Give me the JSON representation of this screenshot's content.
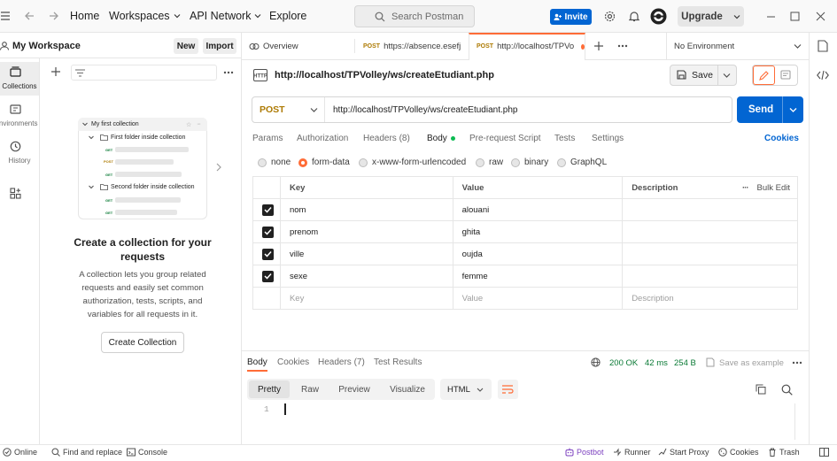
{
  "topbar": {
    "nav": [
      "Home",
      "Workspaces",
      "API Network",
      "Explore"
    ],
    "search_placeholder": "Search Postman",
    "invite_label": "Invite",
    "upgrade_label": "Upgrade"
  },
  "sidebar": {
    "workspace_title": "My Workspace",
    "new_label": "New",
    "import_label": "Import",
    "rail": [
      {
        "label": "Collections",
        "icon": "collections-icon"
      },
      {
        "label": "Environments",
        "icon": "environments-icon"
      },
      {
        "label": "History",
        "icon": "history-icon"
      },
      {
        "label": "",
        "icon": "apps-icon"
      }
    ],
    "illustration": {
      "collection": "My first collection",
      "folder1": "First folder inside collection",
      "folder2": "Second folder inside collection",
      "get": "GET",
      "post": "POST"
    },
    "empty_title": "Create a collection for your requests",
    "empty_desc": "A collection lets you group related requests and easily set common authorization, tests, scripts, and variables for all requests in it.",
    "create_label": "Create Collection"
  },
  "tabs": {
    "overview": "Overview",
    "tab1_method": "POST",
    "tab1_label": "https://absence.esefj",
    "tab2_method": "POST",
    "tab2_label": "http://localhost/TPVo",
    "environment": "No Environment"
  },
  "request": {
    "name": "http://localhost/TPVolley/ws/createEtudiant.php",
    "save_label": "Save",
    "method": "POST",
    "url": "http://localhost/TPVolley/ws/createEtudiant.php",
    "send_label": "Send",
    "tabs": [
      "Params",
      "Authorization",
      "Headers (8)",
      "Body",
      "Pre-request Script",
      "Tests",
      "Settings"
    ],
    "cookies_label": "Cookies",
    "body_types": [
      "none",
      "form-data",
      "x-www-form-urlencoded",
      "raw",
      "binary",
      "GraphQL"
    ],
    "table": {
      "headers": [
        "Key",
        "Value",
        "Description"
      ],
      "bulk_edit": "Bulk Edit",
      "rows": [
        {
          "key": "nom",
          "value": "alouani"
        },
        {
          "key": "prenom",
          "value": "ghita"
        },
        {
          "key": "ville",
          "value": "oujda"
        },
        {
          "key": "sexe",
          "value": "femme"
        }
      ],
      "placeholder": {
        "key": "Key",
        "value": "Value",
        "description": "Description"
      }
    }
  },
  "response": {
    "tabs": [
      "Body",
      "Cookies",
      "Headers (7)",
      "Test Results"
    ],
    "status": "200 OK",
    "time": "42 ms",
    "size": "254 B",
    "save_example": "Save as example",
    "views": [
      "Pretty",
      "Raw",
      "Preview",
      "Visualize"
    ],
    "format": "HTML",
    "line_no": "1"
  },
  "statusbar": {
    "online": "Online",
    "find": "Find and replace",
    "console": "Console",
    "postbot": "Postbot",
    "runner": "Runner",
    "proxy": "Start Proxy",
    "cookies": "Cookies",
    "trash": "Trash"
  },
  "colors": {
    "accent": "#ff6c37",
    "primary": "#0265d2",
    "post": "#ad7a03",
    "success": "#0a7a35"
  }
}
